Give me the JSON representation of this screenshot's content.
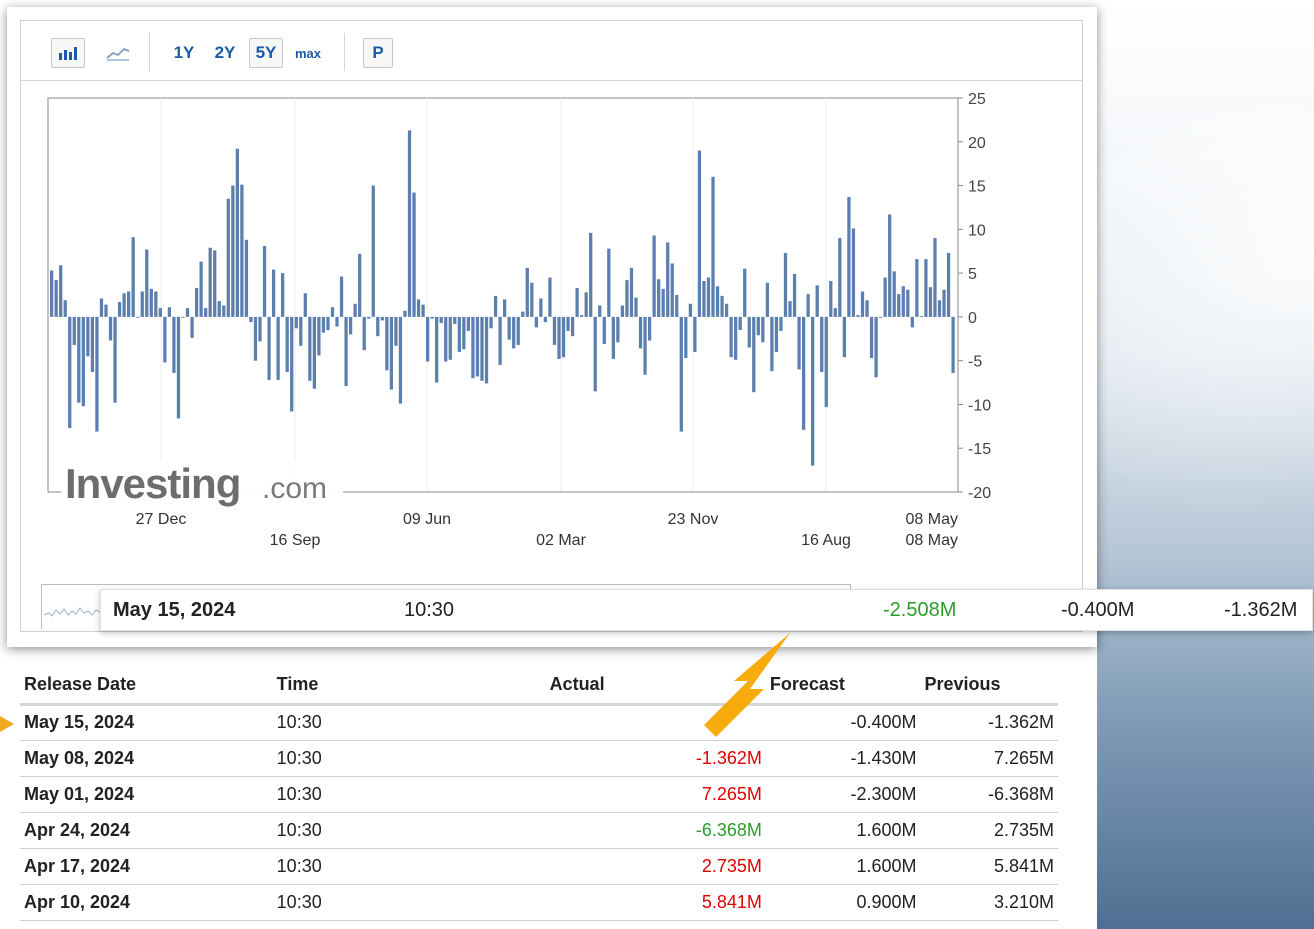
{
  "colors": {
    "bar": "#5b7fae",
    "actual_red": "#e00000",
    "actual_green": "#2a9d2a",
    "arrow": "#f7a600",
    "link": "#1a5aa8"
  },
  "toolbar": {
    "icons": [
      "bar-chart-icon",
      "line-chart-icon"
    ],
    "ranges": [
      "1Y",
      "2Y",
      "5Y",
      "max"
    ],
    "active_range": "5Y",
    "p_label": "P"
  },
  "watermark": {
    "brand": "Investing",
    "suffix": ".com"
  },
  "chart_data": {
    "type": "bar",
    "title": "",
    "ylim": [
      -20,
      25
    ],
    "y_ticks": [
      25,
      20,
      15,
      10,
      5,
      0,
      -5,
      -10,
      -15,
      -20
    ],
    "x_tick_labels_row1": [
      "27 Dec",
      "09 Jun",
      "23 Nov",
      "08 May"
    ],
    "x_tick_labels_row2": [
      "16 Sep",
      "02 Mar",
      "16 Aug",
      "08 May"
    ],
    "grid": true,
    "values": [
      5.3,
      4.2,
      5.9,
      1.9,
      -12.7,
      -3.2,
      -9.8,
      -10.2,
      -4.5,
      -6.3,
      -13.1,
      2.1,
      1.4,
      -2.7,
      -9.8,
      1.7,
      2.7,
      2.9,
      9.1,
      -0.1,
      2.9,
      7.7,
      3.2,
      2.9,
      1.0,
      -5.2,
      1.1,
      -6.4,
      -11.6,
      -0.1,
      1.0,
      -2.4,
      3.3,
      6.3,
      1.0,
      7.9,
      7.6,
      1.8,
      1.3,
      13.5,
      15.0,
      19.2,
      15.1,
      8.8,
      -0.6,
      -5.0,
      -2.8,
      8.1,
      -7.2,
      5.4,
      -7.2,
      5.0,
      -6.3,
      -10.8,
      -1.3,
      -3.3,
      2.7,
      -7.3,
      -8.2,
      -4.4,
      -1.8,
      -1.5,
      1.1,
      -1.1,
      4.6,
      -7.9,
      -2.0,
      1.5,
      7.2,
      -3.8,
      -0.2,
      15.0,
      -2.2,
      -0.4,
      -6.1,
      -8.3,
      -3.3,
      -9.9,
      0.7,
      21.3,
      14.2,
      2.0,
      1.4,
      -5.1,
      -0.2,
      -7.5,
      -0.7,
      -5.1,
      -4.9,
      -0.8,
      -4.0,
      -3.7,
      -1.6,
      -7.0,
      -6.8,
      -7.3,
      -7.6,
      -1.3,
      2.4,
      -5.5,
      2.0,
      -2.6,
      -3.6,
      -3.2,
      0.6,
      5.6,
      3.9,
      -1.2,
      2.1,
      -0.6,
      4.5,
      -3.2,
      -4.8,
      -4.6,
      -1.6,
      -2.2,
      3.3,
      0.2,
      2.8,
      9.6,
      -8.5,
      1.3,
      -3.1,
      7.8,
      -4.8,
      -2.9,
      1.3,
      4.2,
      5.6,
      2.2,
      -3.6,
      -6.6,
      -2.7,
      9.3,
      4.3,
      3.2,
      8.5,
      6.1,
      2.5,
      -13.1,
      -4.7,
      1.5,
      -4.0,
      19.0,
      4.1,
      4.5,
      16.0,
      3.5,
      2.4,
      1.5,
      -4.6,
      -4.9,
      -1.5,
      5.5,
      -3.5,
      -8.6,
      -2.1,
      -2.9,
      3.9,
      -6.2,
      -4.0,
      -1.6,
      7.3,
      1.8,
      4.9,
      -6.0,
      -12.9,
      2.6,
      -17.0,
      3.6,
      -6.3,
      -10.3,
      4.1,
      1.0,
      9.0,
      -4.6,
      13.7,
      10.1,
      0.2,
      2.9,
      1.9,
      -4.7,
      -6.9,
      -0.1,
      4.5,
      11.7,
      5.2,
      2.6,
      3.5,
      3.1,
      -1.2,
      6.6,
      0.1,
      6.6,
      3.4,
      9.0,
      1.9,
      3.1,
      7.3,
      -6.4
    ],
    "series": [
      {
        "values_ref": "values"
      }
    ]
  },
  "popup": {
    "date": "May 15, 2024",
    "time": "10:30",
    "actual": "-2.508M",
    "forecast": "-0.400M",
    "previous": "-1.362M"
  },
  "table": {
    "headers": {
      "date": "Release Date",
      "time": "Time",
      "actual": "Actual",
      "forecast": "Forecast",
      "previous": "Previous"
    },
    "rows": [
      {
        "date": "May 15, 2024",
        "time": "10:30",
        "actual": "",
        "forecast": "-0.400M",
        "previous": "-1.362M",
        "color": ""
      },
      {
        "date": "May 08, 2024",
        "time": "10:30",
        "actual": "-1.362M",
        "forecast": "-1.430M",
        "previous": "7.265M",
        "color": "neg"
      },
      {
        "date": "May 01, 2024",
        "time": "10:30",
        "actual": "7.265M",
        "forecast": "-2.300M",
        "previous": "-6.368M",
        "color": "neg"
      },
      {
        "date": "Apr 24, 2024",
        "time": "10:30",
        "actual": "-6.368M",
        "forecast": "1.600M",
        "previous": "2.735M",
        "color": "pos"
      },
      {
        "date": "Apr 17, 2024",
        "time": "10:30",
        "actual": "2.735M",
        "forecast": "1.600M",
        "previous": "5.841M",
        "color": "neg"
      },
      {
        "date": "Apr 10, 2024",
        "time": "10:30",
        "actual": "5.841M",
        "forecast": "0.900M",
        "previous": "3.210M",
        "color": "neg"
      }
    ]
  }
}
